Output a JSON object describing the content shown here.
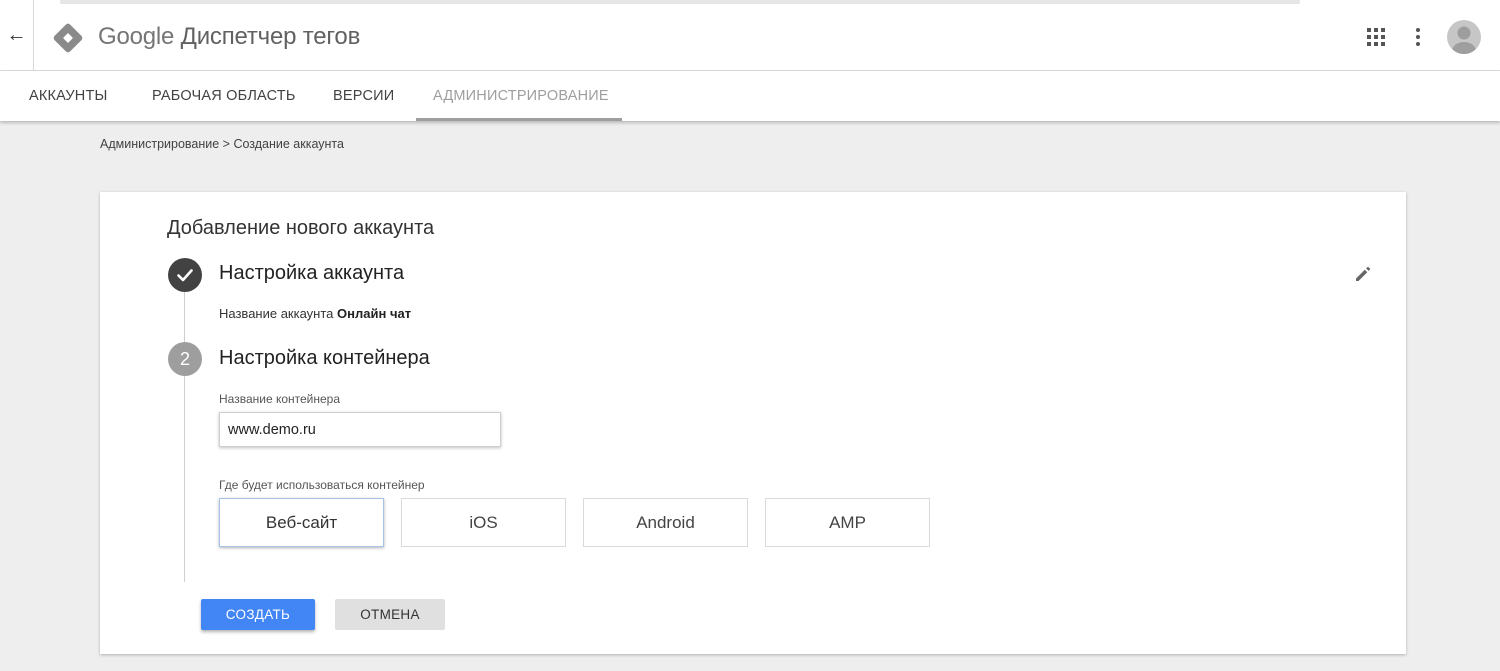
{
  "header": {
    "logo_google": "Google",
    "logo_product": "Диспетчер тегов",
    "back_icon": "←"
  },
  "tabs": [
    {
      "label": "АККАУНТЫ",
      "active": false
    },
    {
      "label": "РАБОЧАЯ ОБЛАСТЬ",
      "active": false
    },
    {
      "label": "ВЕРСИИ",
      "active": false
    },
    {
      "label": "АДМИНИСТРИРОВАНИЕ",
      "active": true
    }
  ],
  "breadcrumb": "Администрирование > Создание аккаунта",
  "card": {
    "title": "Добавление нового аккаунта",
    "step1": {
      "title": "Настройка аккаунта",
      "summary_label": "Название аккаунта",
      "summary_value": "Онлайн чат"
    },
    "step2": {
      "number": "2",
      "title": "Настройка контейнера",
      "container_name_label": "Название контейнера",
      "container_name_value": "www.demo.ru",
      "platform_label": "Где будет использоваться контейнер",
      "platforms": [
        {
          "label": "Веб-сайт",
          "selected": true
        },
        {
          "label": "iOS",
          "selected": false
        },
        {
          "label": "Android",
          "selected": false
        },
        {
          "label": "AMP",
          "selected": false
        }
      ]
    },
    "actions": {
      "create_label": "СОЗДАТЬ",
      "cancel_label": "ОТМЕНА"
    }
  },
  "colors": {
    "primary": "#4285f4",
    "logo_diamond": "#8a8a8a",
    "step_done": "#424242",
    "step_pending": "#9e9e9e"
  }
}
